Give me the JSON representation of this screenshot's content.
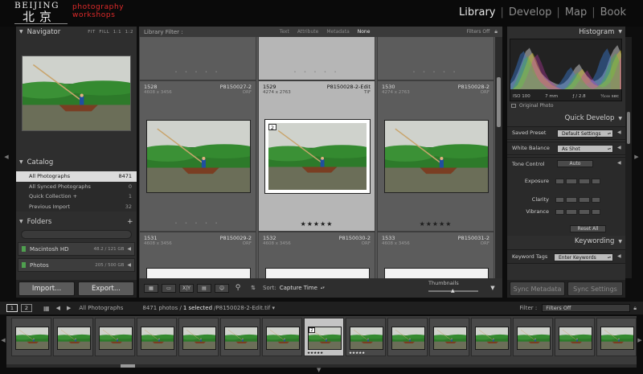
{
  "brand": {
    "line1": "BEIJING",
    "line2": "北京",
    "sub1": "photography",
    "sub2": "workshops"
  },
  "modules": [
    {
      "label": "Library",
      "active": true
    },
    {
      "label": "Develop",
      "active": false
    },
    {
      "label": "Map",
      "active": false
    },
    {
      "label": "Book",
      "active": false
    }
  ],
  "navigator": {
    "title": "Navigator",
    "zoom": [
      "FIT",
      "FILL",
      "1:1",
      "1:2"
    ]
  },
  "catalog": {
    "title": "Catalog",
    "items": [
      {
        "label": "All Photographs",
        "count": "8471",
        "selected": true
      },
      {
        "label": "All Synced Photographs",
        "count": "0",
        "selected": false
      },
      {
        "label": "Quick Collection +",
        "count": "1",
        "selected": false
      },
      {
        "label": "Previous Import",
        "count": "32",
        "selected": false
      }
    ]
  },
  "folders": {
    "title": "Folders",
    "add": "+",
    "drives": [
      {
        "label": "Macintosh HD",
        "cap": "48.2 / 121 GB"
      },
      {
        "label": "Photos",
        "cap": "205 / 500 GB"
      }
    ]
  },
  "left_buttons": {
    "import": "Import...",
    "export": "Export..."
  },
  "filter": {
    "title": "Library Filter :",
    "tabs": [
      "Text",
      "Attribute",
      "Metadata",
      "None"
    ],
    "active": "None",
    "status": "Filters Off"
  },
  "grid": {
    "cells": [
      {
        "num": "1528",
        "name": "P8150027-2",
        "dims": "4608 x 3456",
        "ext": "ORF",
        "stars": "",
        "selected": false,
        "badge": ""
      },
      {
        "num": "1529",
        "name": "P8150028-2-Edit",
        "dims": "4274 x 2763",
        "ext": "TIF",
        "stars": "★★★★★",
        "selected": true,
        "badge": "2"
      },
      {
        "num": "1530",
        "name": "P8150028-2",
        "dims": "4274 x 2763",
        "ext": "ORF",
        "stars": "★★★★★",
        "selected": false,
        "badge": ""
      },
      {
        "num": "1531",
        "name": "P8150029-2",
        "dims": "4608 x 3456",
        "ext": "ORF",
        "stars": "",
        "selected": false,
        "badge": ""
      },
      {
        "num": "1532",
        "name": "P8150030-2",
        "dims": "4608 x 3456",
        "ext": "ORF",
        "stars": "",
        "selected": false,
        "badge": ""
      },
      {
        "num": "1533",
        "name": "P8150031-2",
        "dims": "4608 x 3456",
        "ext": "ORF",
        "stars": "",
        "selected": false,
        "badge": ""
      }
    ]
  },
  "toolbar": {
    "sort_label": "Sort:",
    "sort_value": "Capture Time",
    "thumbs_label": "Thumbnails",
    "xy": "X|Y"
  },
  "histogram": {
    "title": "Histogram",
    "iso": "ISO 100",
    "focal": "7 mm",
    "aperture": "ƒ / 2.8",
    "shutter": "¹⁄₁₀₀₀ sec",
    "original": "Original Photo",
    "curve_heights": [
      0.12,
      0.2,
      0.38,
      0.6,
      0.84,
      0.92,
      0.74,
      0.52,
      0.36,
      0.28,
      0.2,
      0.16,
      0.12,
      0.1,
      0.14,
      0.22,
      0.34,
      0.48,
      0.56,
      0.42,
      0.3,
      0.22,
      0.18,
      0.22,
      0.3,
      0.46,
      0.7,
      0.88,
      0.98,
      0.78
    ]
  },
  "quick_develop": {
    "title": "Quick Develop",
    "saved_preset": {
      "label": "Saved Preset",
      "value": "Default Settings"
    },
    "white_balance": {
      "label": "White Balance",
      "value": "As Shot"
    },
    "tone": {
      "label": "Tone Control",
      "auto": "Auto",
      "rows": [
        "Exposure",
        "Clarity",
        "Vibrance"
      ]
    },
    "reset": "Reset All"
  },
  "keywording": {
    "title": "Keywording",
    "tags_label": "Keyword Tags",
    "tags_value": "Enter Keywords"
  },
  "right_buttons": {
    "sync_meta": "Sync Metadata",
    "sync_settings": "Sync Settings"
  },
  "filmstrip_bar": {
    "pages": [
      "1",
      "2"
    ],
    "source": "All Photographs",
    "summary": "8471 photos /",
    "selected_txt": "1 selected",
    "file": "/P8150028-2-Edit.tif ▾",
    "filter_label": "Filter :",
    "filter_value": "Filters Off"
  },
  "filmstrip": {
    "count": 15,
    "selected_index": 7,
    "starred": [
      7,
      8
    ],
    "stars": "★★★★★",
    "sel_badge": "2"
  },
  "colors": {
    "accent_selected": "#dcdcdc",
    "panel": "#2e2e2e",
    "grid": "#565656",
    "logo_red": "#e02a2a",
    "drive_led": "#4fa04f"
  }
}
